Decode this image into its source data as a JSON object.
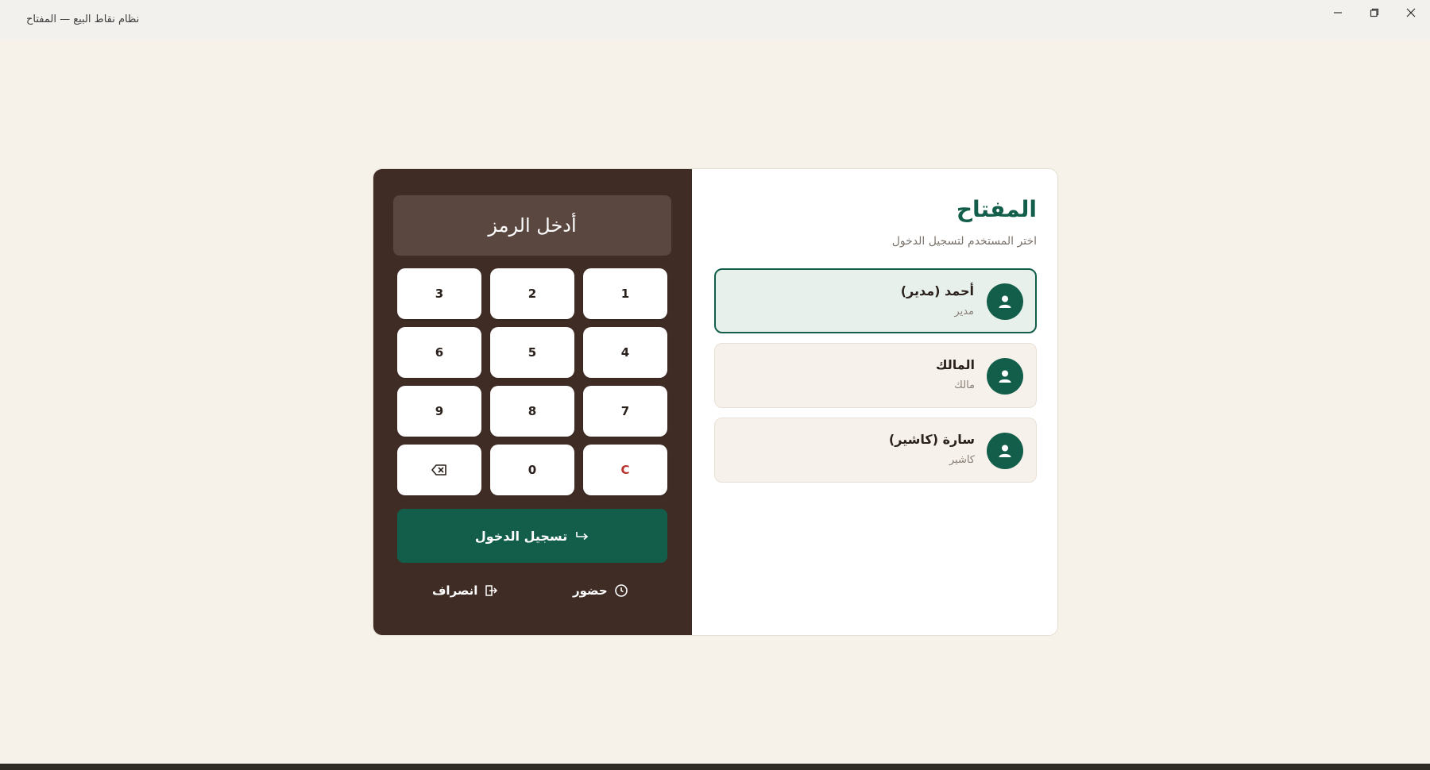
{
  "window": {
    "title": "نظام نقاط البيع — المفتاح"
  },
  "pinpad": {
    "display_placeholder": "أدخل الرمز",
    "keys": [
      "1",
      "2",
      "3",
      "4",
      "5",
      "6",
      "7",
      "8",
      "9",
      "C",
      "0",
      "⌫"
    ],
    "login_label": "تسجيل الدخول",
    "attendance_label": "حضور",
    "leave_label": "انصراف"
  },
  "users_panel": {
    "brand": "المفتاح",
    "subtitle": "اختر المستخدم لتسجيل الدخول",
    "users": [
      {
        "name": "أحمد (مدير)",
        "role": "مدير",
        "selected": true
      },
      {
        "name": "المالك",
        "role": "مالك",
        "selected": false
      },
      {
        "name": "سارة (كاشير)",
        "role": "كاشير",
        "selected": false
      }
    ]
  },
  "colors": {
    "accent": "#135e4b",
    "pad_background": "#3f2c25",
    "page_background": "#f6f2ea",
    "clear_key": "#b8302a"
  },
  "icons": {
    "login": "enter-arrow-icon",
    "attendance": "clock-icon",
    "leave": "logout-icon",
    "backspace": "backspace-icon",
    "user": "user-icon"
  }
}
